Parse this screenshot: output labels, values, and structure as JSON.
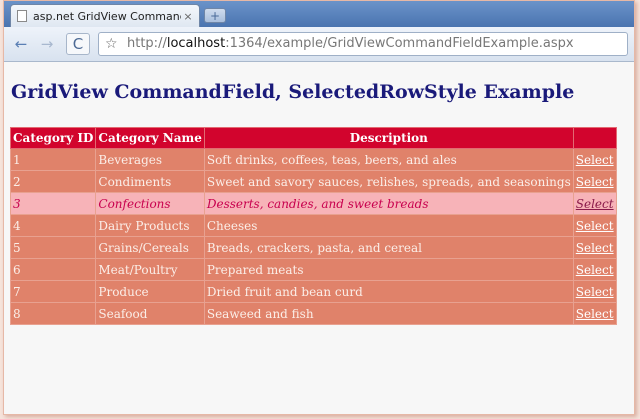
{
  "browser": {
    "tab_title": "asp.net GridView Command…",
    "close_glyph": "×",
    "new_tab_glyph": "+",
    "back_glyph": "←",
    "forward_glyph": "→",
    "reload_glyph": "C",
    "star_glyph": "☆",
    "url_scheme": "http://",
    "url_host": "localhost",
    "url_rest": ":1364/example/GridViewCommandFieldExample.aspx"
  },
  "page": {
    "title": "GridView CommandField, SelectedRowStyle Example"
  },
  "grid": {
    "headers": [
      "Category ID",
      "Category Name",
      "Description",
      ""
    ],
    "select_label": "Select",
    "rows": [
      {
        "id": "1",
        "name": "Beverages",
        "desc": "Soft drinks, coffees, teas, beers, and ales"
      },
      {
        "id": "2",
        "name": "Condiments",
        "desc": "Sweet and savory sauces, relishes, spreads, and seasonings"
      },
      {
        "id": "3",
        "name": "Confections",
        "desc": "Desserts, candies, and sweet breads"
      },
      {
        "id": "4",
        "name": "Dairy Products",
        "desc": "Cheeses"
      },
      {
        "id": "5",
        "name": "Grains/Cereals",
        "desc": "Breads, crackers, pasta, and cereal"
      },
      {
        "id": "6",
        "name": "Meat/Poultry",
        "desc": "Prepared meats"
      },
      {
        "id": "7",
        "name": "Produce",
        "desc": "Dried fruit and bean curd"
      },
      {
        "id": "8",
        "name": "Seafood",
        "desc": "Seaweed and fish"
      }
    ],
    "selected_index": 2
  },
  "colors": {
    "header_bg": "#d2042d",
    "row_bg": "#e0826a",
    "selected_bg": "#f7b3b8",
    "selected_text": "#c8004e",
    "title_color": "#1a1a7a"
  }
}
